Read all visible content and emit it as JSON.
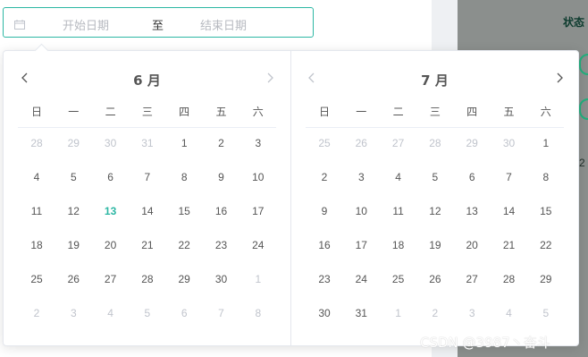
{
  "background": {
    "status_label": "状态",
    "partial_digit": "2"
  },
  "range_input": {
    "start_placeholder": "开始日期",
    "separator": "至",
    "end_placeholder": "结束日期",
    "accent_color": "#2db7a4"
  },
  "picker": {
    "weekdays": [
      "日",
      "一",
      "二",
      "三",
      "四",
      "五",
      "六"
    ],
    "left": {
      "month_label": "6 月",
      "weeks": [
        [
          {
            "d": "28",
            "m": true
          },
          {
            "d": "29",
            "m": true
          },
          {
            "d": "30",
            "m": true
          },
          {
            "d": "31",
            "m": true
          },
          {
            "d": "1"
          },
          {
            "d": "2"
          },
          {
            "d": "3"
          }
        ],
        [
          {
            "d": "4"
          },
          {
            "d": "5"
          },
          {
            "d": "6"
          },
          {
            "d": "7"
          },
          {
            "d": "8"
          },
          {
            "d": "9"
          },
          {
            "d": "10"
          }
        ],
        [
          {
            "d": "11"
          },
          {
            "d": "12"
          },
          {
            "d": "13",
            "today": true
          },
          {
            "d": "14"
          },
          {
            "d": "15"
          },
          {
            "d": "16"
          },
          {
            "d": "17"
          }
        ],
        [
          {
            "d": "18"
          },
          {
            "d": "19"
          },
          {
            "d": "20"
          },
          {
            "d": "21"
          },
          {
            "d": "22"
          },
          {
            "d": "23"
          },
          {
            "d": "24"
          }
        ],
        [
          {
            "d": "25"
          },
          {
            "d": "26"
          },
          {
            "d": "27"
          },
          {
            "d": "28"
          },
          {
            "d": "29"
          },
          {
            "d": "30"
          },
          {
            "d": "1",
            "m": true
          }
        ],
        [
          {
            "d": "2",
            "m": true
          },
          {
            "d": "3",
            "m": true
          },
          {
            "d": "4",
            "m": true
          },
          {
            "d": "5",
            "m": true
          },
          {
            "d": "6",
            "m": true
          },
          {
            "d": "7",
            "m": true
          },
          {
            "d": "8",
            "m": true
          }
        ]
      ]
    },
    "right": {
      "month_label": "7 月",
      "weeks": [
        [
          {
            "d": "25",
            "m": true
          },
          {
            "d": "26",
            "m": true
          },
          {
            "d": "27",
            "m": true
          },
          {
            "d": "28",
            "m": true
          },
          {
            "d": "29",
            "m": true
          },
          {
            "d": "30",
            "m": true
          },
          {
            "d": "1"
          }
        ],
        [
          {
            "d": "2"
          },
          {
            "d": "3"
          },
          {
            "d": "4"
          },
          {
            "d": "5"
          },
          {
            "d": "6"
          },
          {
            "d": "7"
          },
          {
            "d": "8"
          }
        ],
        [
          {
            "d": "9"
          },
          {
            "d": "10"
          },
          {
            "d": "11"
          },
          {
            "d": "12"
          },
          {
            "d": "13"
          },
          {
            "d": "14"
          },
          {
            "d": "15"
          }
        ],
        [
          {
            "d": "16"
          },
          {
            "d": "17"
          },
          {
            "d": "18"
          },
          {
            "d": "19"
          },
          {
            "d": "20"
          },
          {
            "d": "21"
          },
          {
            "d": "22"
          }
        ],
        [
          {
            "d": "23"
          },
          {
            "d": "24"
          },
          {
            "d": "25"
          },
          {
            "d": "26"
          },
          {
            "d": "27"
          },
          {
            "d": "28"
          },
          {
            "d": "29"
          }
        ],
        [
          {
            "d": "30"
          },
          {
            "d": "31"
          },
          {
            "d": "1",
            "m": true
          },
          {
            "d": "2",
            "m": true
          },
          {
            "d": "3",
            "m": true
          },
          {
            "d": "4",
            "m": true
          },
          {
            "d": "5",
            "m": true
          }
        ]
      ]
    }
  },
  "watermark": "CSDN @3987丶奋斗"
}
